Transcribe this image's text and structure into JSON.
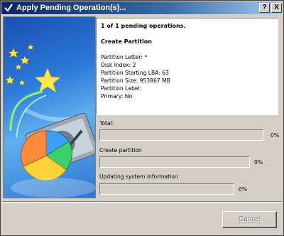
{
  "window": {
    "title": "Apply Pending Operation(s)...",
    "help_label": "?",
    "close_label": "X"
  },
  "info": {
    "header": "1 of 1 pending operations.",
    "operation_title": "Create Partition",
    "details": [
      "Partition Letter: *",
      "Disk Index: 2",
      "Partition Starting LBA: 63",
      "Partition Size: 953867 MB",
      "Partition Label:",
      "Primary: No"
    ]
  },
  "progress": [
    {
      "label": "Total:",
      "percent_text": "0%",
      "value": 0
    },
    {
      "label": "Create partition",
      "percent_text": "0%",
      "value": 0
    },
    {
      "label": "Updating system information",
      "percent_text": "0%",
      "value": 0
    }
  ],
  "buttons": {
    "cancel_label": "Cancel",
    "cancel_enabled": false
  },
  "icons": {
    "title_icon": "checkmark-icon",
    "art": "disk-wizard-illustration"
  }
}
